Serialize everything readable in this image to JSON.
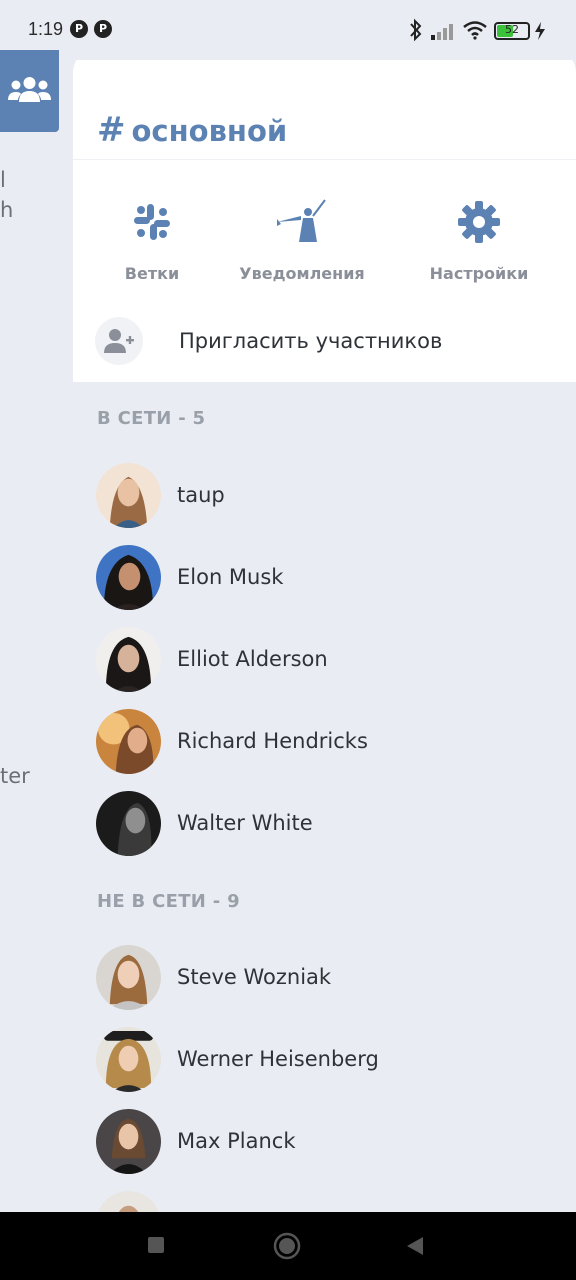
{
  "status": {
    "time": "1:19",
    "battery": "52"
  },
  "background": {
    "text1": "l",
    "text2": "h",
    "text3": "ter"
  },
  "channel": {
    "hash": "#",
    "name": "основной"
  },
  "actions": {
    "threads": "Ветки",
    "notifications": "Уведомления",
    "settings": "Настройки"
  },
  "invite": {
    "label": "Пригласить участников"
  },
  "online": {
    "header": "В СЕТИ - 5",
    "members": [
      {
        "name": "taup"
      },
      {
        "name": "Elon Musk"
      },
      {
        "name": "Elliot Alderson"
      },
      {
        "name": "Richard Hendricks"
      },
      {
        "name": "Walter White"
      }
    ]
  },
  "offline": {
    "header": "НЕ В СЕТИ - 9",
    "members": [
      {
        "name": "Steve Wozniak"
      },
      {
        "name": "Werner Heisenberg"
      },
      {
        "name": "Max Planck"
      }
    ]
  },
  "colors": {
    "accent": "#5b82b3",
    "muted": "#8a8f99",
    "panel_bg": "#e9edf3"
  }
}
